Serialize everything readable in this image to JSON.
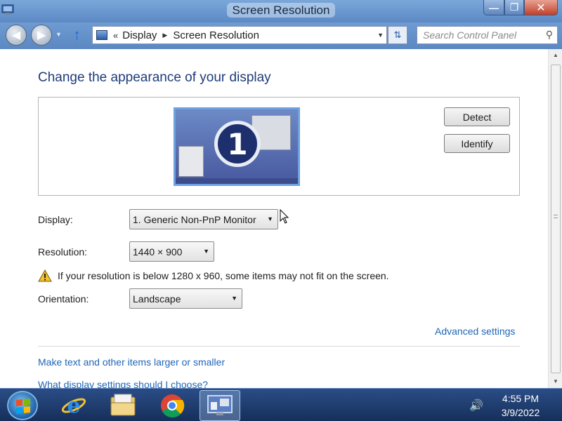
{
  "window": {
    "title": "Screen Resolution",
    "minimize": "—",
    "maximize": "❐",
    "close": "✕"
  },
  "navbar": {
    "breadcrumb": [
      "Display",
      "Screen Resolution"
    ],
    "search_placeholder": "Search Control Panel"
  },
  "content": {
    "heading": "Change the appearance of your display",
    "monitor_number": "1",
    "detect_label": "Detect",
    "identify_label": "Identify",
    "display_label": "Display:",
    "display_value": "1. Generic Non-PnP Monitor",
    "resolution_label": "Resolution:",
    "resolution_value": "1440 × 900",
    "warning_text": "If your resolution is below 1280 x 960, some items may not fit on the screen.",
    "orientation_label": "Orientation:",
    "orientation_value": "Landscape",
    "advanced_link": "Advanced settings",
    "links": [
      "Make text and other items larger or smaller",
      "What display settings should I choose?"
    ]
  },
  "taskbar": {
    "apps": [
      "internet-explorer",
      "windows-explorer",
      "google-chrome",
      "control-panel-display"
    ],
    "active_app": "control-panel-display",
    "time": "4:55 PM",
    "date": "3/9/2022"
  }
}
